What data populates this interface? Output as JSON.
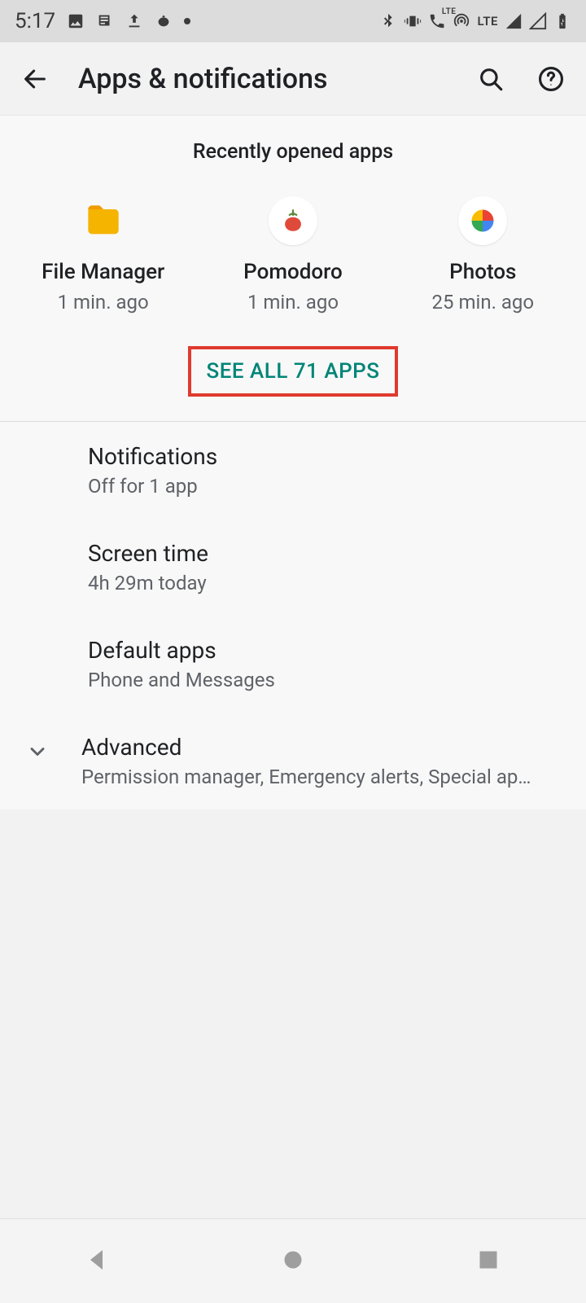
{
  "status": {
    "time": "5:17",
    "lte": "LTE"
  },
  "header": {
    "title": "Apps & notifications"
  },
  "recent": {
    "header": "Recently opened apps",
    "apps": [
      {
        "name": "File Manager",
        "time": "1 min. ago"
      },
      {
        "name": "Pomodoro",
        "time": "1 min. ago"
      },
      {
        "name": "Photos",
        "time": "25 min. ago"
      }
    ],
    "see_all": "SEE ALL 71 APPS"
  },
  "settings": [
    {
      "title": "Notifications",
      "sub": "Off for 1 app"
    },
    {
      "title": "Screen time",
      "sub": "4h 29m today"
    },
    {
      "title": "Default apps",
      "sub": "Phone and Messages"
    },
    {
      "title": "Advanced",
      "sub": "Permission manager, Emergency alerts, Special app a.."
    }
  ]
}
